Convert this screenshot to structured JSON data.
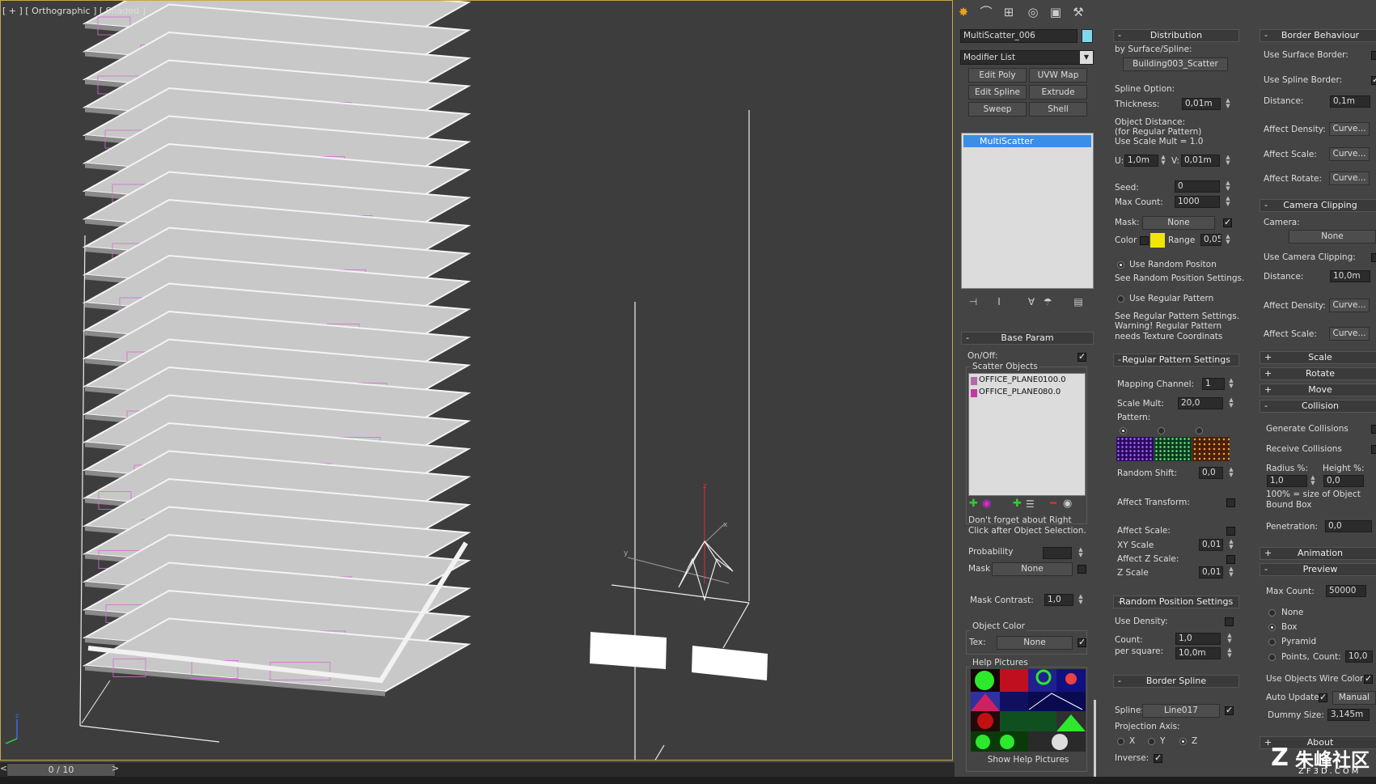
{
  "viewport": {
    "label": "[ + ] [ Orthographic ] [ Shaded ]",
    "timeline": "0 / 10",
    "timeline_arrow_left": "<",
    "timeline_arrow_right": ">"
  },
  "command_panel": {
    "object_name": "MultiScatter_006",
    "object_color": "#7fd9ea",
    "modifier_list": "Modifier List",
    "mod_buttons": [
      "Edit Poly",
      "UVW Map",
      "Edit Spline",
      "Extrude",
      "Sweep",
      "Shell"
    ],
    "stack_item": "MultiScatter"
  },
  "base_param": {
    "title": "Base Param",
    "on_off": "On/Off:",
    "scatter_objects": "Scatter Objects",
    "items": [
      {
        "name": "OFFICE_PLANE0",
        "value": "100.0",
        "color": "#b06aa8"
      },
      {
        "name": "OFFICE_PLANE0",
        "value": "80.0",
        "color": "#c03aa0"
      }
    ],
    "note": "Don't forget about Right Click after Object Selection.",
    "probability": "Probability",
    "mask": "Mask",
    "mask_value": "None",
    "mask_contrast": "Mask Contrast:",
    "mask_contrast_value": "1,0",
    "object_color": "Object Color",
    "tex": "Tex:",
    "tex_value": "None",
    "help_pictures": "Help Pictures",
    "show_help": "Show Help Pictures"
  },
  "distribution": {
    "title": "Distribution",
    "by_surface": "by Surface/Spline:",
    "surface_value": "Building003_Scatter",
    "spline_option": "Spline Option:",
    "thickness": "Thickness:",
    "thickness_value": "0,01m",
    "object_distance": "Object Distance:",
    "for_regular": "(for Regular Pattern)",
    "use_scale_mult": "Use Scale Mult = 1.0",
    "u": "U:",
    "u_value": "1,0m",
    "v": "V:",
    "v_value": "0,01m",
    "seed": "Seed:",
    "seed_value": "0",
    "max_count": "Max Count:",
    "max_count_value": "1000",
    "mask": "Mask:",
    "mask_value": "None",
    "color": "Color",
    "color_swatch": "#f2e600",
    "range": "Range",
    "range_value": "0,05",
    "use_random": "Use Random Positon",
    "see_random": "See Random Position Settings.",
    "use_regular": "Use Regular Pattern",
    "see_regular": "See Regular Pattern Settings.",
    "warning": "Warning! Regular Pattern",
    "needs": "needs Texture Coordinats"
  },
  "regular_pattern": {
    "title": "Regular Pattern Settings",
    "mapping_channel": "Mapping Channel:",
    "mapping_value": "1",
    "scale_mult": "Scale Mult:",
    "scale_mult_value": "20,0",
    "pattern": "Pattern:",
    "random_shift": "Random Shift:",
    "random_shift_value": "0,0",
    "affect_transform": "Affect Transform:",
    "affect_scale": "Affect Scale:",
    "xy_scale": "XY Scale",
    "xy_scale_value": "0,01",
    "affect_z_scale": "Affect Z Scale:",
    "z_scale": "Z Scale",
    "z_scale_value": "0,01"
  },
  "random_position": {
    "title": "Random Position Settings",
    "use_density": "Use Density:",
    "count": "Count:",
    "count_value": "1,0",
    "per_square": "per square:",
    "per_square_value": "10,0m"
  },
  "border_spline": {
    "title": "Border Spline",
    "spline": "Spline:",
    "spline_value": "Line017",
    "projection_axis": "Projection Axis:",
    "axes": [
      "X",
      "Y",
      "Z"
    ],
    "inverse": "Inverse:"
  },
  "border_behaviour": {
    "title": "Border Behaviour",
    "use_surface_border": "Use Surface Border:",
    "use_spline_border": "Use Spline Border:",
    "distance": "Distance:",
    "distance_value": "0,1m",
    "affect_density": "Affect Density:",
    "affect_scale": "Affect Scale:",
    "affect_rotate": "Affect Rotate:",
    "curve": "Curve..."
  },
  "camera_clipping": {
    "title": "Camera Clipping",
    "camera": "Camera:",
    "camera_value": "None",
    "use_camera_clipping": "Use Camera Clipping:",
    "distance": "Distance:",
    "distance_value": "10,0m",
    "affect_density": "Affect Density:",
    "affect_scale": "Affect Scale:",
    "curve": "Curve..."
  },
  "rollouts": {
    "scale": "Scale",
    "rotate": "Rotate",
    "move": "Move",
    "collision": "Collision",
    "animation": "Animation",
    "preview": "Preview",
    "about": "About"
  },
  "collision": {
    "generate": "Generate Collisions",
    "receive": "Receive Collisions",
    "radius": "Radius %:",
    "radius_value": "1,0",
    "height": "Height %:",
    "height_value": "0,0",
    "note": "100% = size of Object Bound Box",
    "penetration": "Penetration:",
    "penetration_value": "0,0"
  },
  "preview": {
    "max_count": "Max Count:",
    "max_count_value": "50000",
    "none": "None",
    "box": "Box",
    "pyramid": "Pyramid",
    "points": "Points,",
    "count": "Count:",
    "count_value": "10,0",
    "use_wire": "Use Objects Wire Color",
    "auto_update": "Auto Update",
    "manual": "Manual",
    "dummy_size": "Dummy Size:",
    "dummy_size_value": "3,145m"
  },
  "watermark": {
    "text": "朱峰社区",
    "sub": "ZF3D.COM"
  }
}
